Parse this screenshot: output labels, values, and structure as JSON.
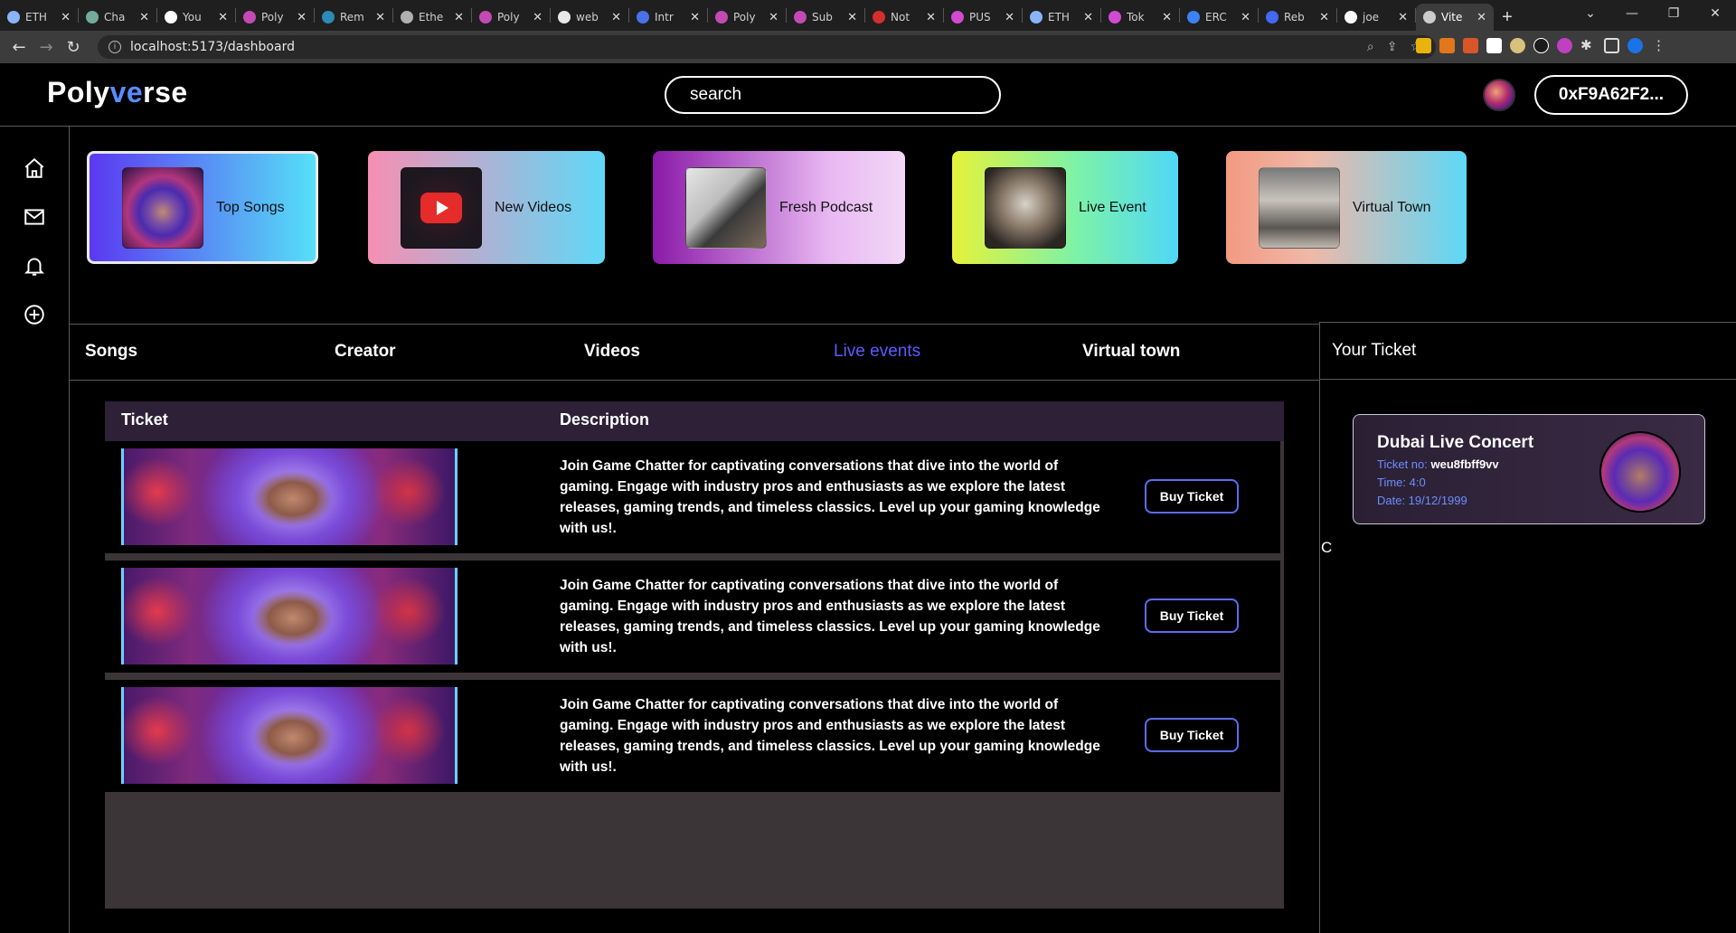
{
  "browser": {
    "tabs": [
      {
        "title": "ETH",
        "color": "#8ab4f8"
      },
      {
        "title": "Cha",
        "color": "#74aa9c"
      },
      {
        "title": "You",
        "color": "#ffffff"
      },
      {
        "title": "Poly",
        "color": "#c34ab5"
      },
      {
        "title": "Rem",
        "color": "#2b8ab6"
      },
      {
        "title": "Ethe",
        "color": "#b0b0b0"
      },
      {
        "title": "Poly",
        "color": "#c34ab5"
      },
      {
        "title": "web",
        "color": "#e8e8e8"
      },
      {
        "title": "Intr",
        "color": "#4a72e8"
      },
      {
        "title": "Poly",
        "color": "#c34ab5"
      },
      {
        "title": "Sub",
        "color": "#c34ab5"
      },
      {
        "title": "Not",
        "color": "#d32f2f"
      },
      {
        "title": "PUS",
        "color": "#d14bd1"
      },
      {
        "title": "ETH",
        "color": "#8ab4f8"
      },
      {
        "title": "Tok",
        "color": "#d14bd1"
      },
      {
        "title": "ERC",
        "color": "#3b82f6"
      },
      {
        "title": "Reb",
        "color": "#4468f2"
      },
      {
        "title": "joe",
        "color": "#ffffff"
      },
      {
        "title": "Vite",
        "color": "#cccccc"
      }
    ],
    "new_tab": "+",
    "url": "localhost:5173/dashboard"
  },
  "header": {
    "logo_part1": "Poly",
    "logo_part2": "ve",
    "logo_part3": "rse",
    "search_placeholder": "search",
    "wallet": "0xF9A62F2..."
  },
  "categories": [
    {
      "label": "Top Songs"
    },
    {
      "label": "New Videos"
    },
    {
      "label": "Fresh Podcast"
    },
    {
      "label": "Live Event"
    },
    {
      "label": "Virtual Town"
    }
  ],
  "tabs": [
    {
      "label": "Songs"
    },
    {
      "label": "Creator"
    },
    {
      "label": "Videos"
    },
    {
      "label": "Live events"
    },
    {
      "label": "Virtual town"
    }
  ],
  "table": {
    "col_ticket": "Ticket",
    "col_description": "Description",
    "rows": [
      {
        "description": "Join Game Chatter for captivating conversations that dive into the world of gaming. Engage with industry pros and enthusiasts as we explore the latest releases, gaming trends, and timeless classics. Level up your gaming knowledge with us!.",
        "button": "Buy Ticket"
      },
      {
        "description": "Join Game Chatter for captivating conversations that dive into the world of gaming. Engage with industry pros and enthusiasts as we explore the latest releases, gaming trends, and timeless classics. Level up your gaming knowledge with us!.",
        "button": "Buy Ticket"
      },
      {
        "description": "Join Game Chatter for captivating conversations that dive into the world of gaming. Engage with industry pros and enthusiasts as we explore the latest releases, gaming trends, and timeless classics. Level up your gaming knowledge with us!.",
        "button": "Buy Ticket"
      }
    ]
  },
  "your_ticket": {
    "title": "Your Ticket",
    "name": "Dubai Live Concert",
    "ticket_no_label": "Ticket no:",
    "ticket_no": "weu8fbff9vv",
    "time": "Time: 4:0",
    "date": "Date: 19/12/1999",
    "stray_text": "C"
  },
  "colors": {
    "accent": "#5b5bff",
    "active_tab": "#5b5bff"
  }
}
